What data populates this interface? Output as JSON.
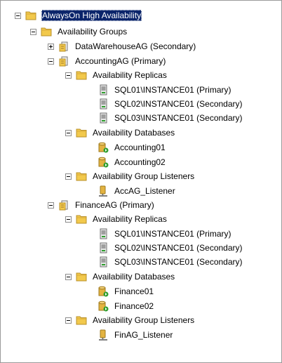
{
  "tree": {
    "root": "AlwaysOn High Availability",
    "groups_folder": "Availability Groups",
    "ag_warehouse": "DataWarehouseAG (Secondary)",
    "ag_accounting": {
      "label": "AccountingAG (Primary)",
      "replicas_folder": "Availability Replicas",
      "replicas": [
        "SQL01\\INSTANCE01 (Primary)",
        "SQL02\\INSTANCE01 (Secondary)",
        "SQL03\\INSTANCE01 (Secondary)"
      ],
      "databases_folder": "Availability Databases",
      "databases": [
        "Accounting01",
        "Accounting02"
      ],
      "listeners_folder": "Availability Group Listeners",
      "listener": "AccAG_Listener"
    },
    "ag_finance": {
      "label": "FinanceAG (Primary)",
      "replicas_folder": "Availability Replicas",
      "replicas": [
        "SQL01\\INSTANCE01 (Primary)",
        "SQL02\\INSTANCE01 (Secondary)",
        "SQL03\\INSTANCE01 (Secondary)"
      ],
      "databases_folder": "Availability Databases",
      "databases": [
        "Finance01",
        "Finance02"
      ],
      "listeners_folder": "Availability Group Listeners",
      "listener": "FinAG_Listener"
    }
  },
  "colors": {
    "selection": "#0a246a",
    "folder": "#f2c94c",
    "database": "#e3b341",
    "status_green": "#2e9e2e"
  }
}
